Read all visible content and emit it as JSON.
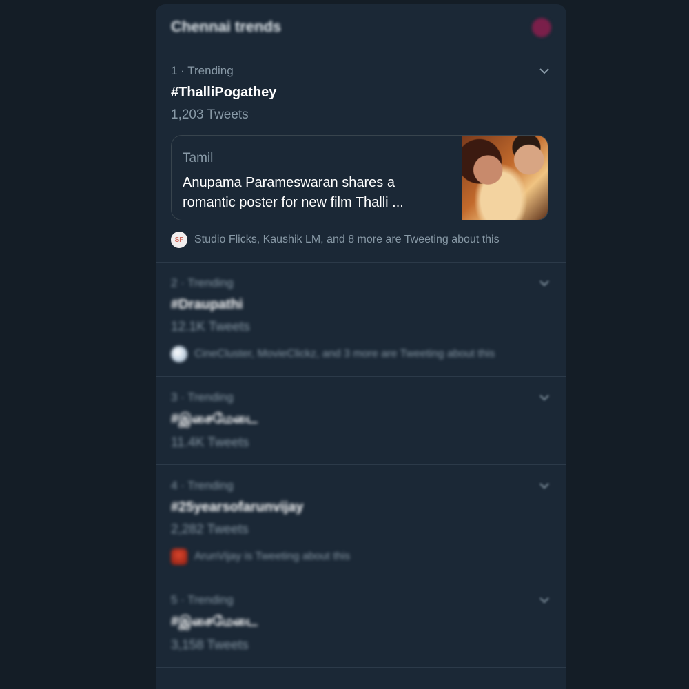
{
  "header": {
    "title": "Chennai trends",
    "settings_icon": "gear-icon"
  },
  "trends": [
    {
      "meta": "1 · Trending",
      "name": "#ThalliPogathey",
      "count": "1,203 Tweets",
      "card": {
        "source": "Tamil",
        "headline": "Anupama Parameswaran shares a romantic poster for new film Thalli ..."
      },
      "tweeting": "Studio Flicks, Kaushik LM, and 8 more are Tweeting about this",
      "avatar_label": "SF"
    },
    {
      "meta": "2 · Trending",
      "name": "#Draupathi",
      "count": "12.1K Tweets",
      "tweeting": "CineCluster, MovieClickz, and 3 more are Tweeting about this"
    },
    {
      "meta": "3 · Trending",
      "name": "#இசைமேடை",
      "count": "11.4K Tweets"
    },
    {
      "meta": "4 · Trending",
      "name": "#25yearsofarunvijay",
      "count": "2,282 Tweets",
      "tweeting": "ArunVijay is Tweeting about this"
    },
    {
      "meta": "5 · Trending",
      "name": "#இசைமேடை",
      "count": "3,158 Tweets"
    }
  ]
}
